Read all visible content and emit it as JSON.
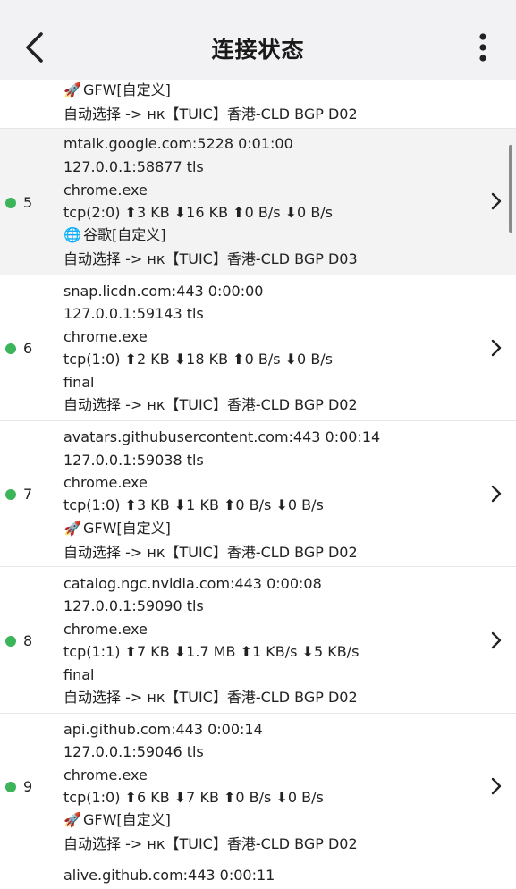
{
  "header": {
    "title": "连接状态"
  },
  "partial_top": {
    "rule": "GFW[自定义]",
    "rule_icon": "rocket-icon",
    "chain": "自动选择 -> нк【TUIC】香港-CLD BGP D02"
  },
  "rows": [
    {
      "index": "5",
      "host": "mtalk.google.com:5228  0:01:00",
      "src": "127.0.0.1:58877  tls",
      "process": "chrome.exe",
      "stats": "tcp(2:0)  ⬆3 KB  ⬇16 KB  ⬆0 B/s  ⬇0 B/s",
      "rule": "谷歌[自定义]",
      "rule_icon": "globe-icon",
      "chain": "自动选择 -> нк【TUIC】香港-CLD BGP D03"
    },
    {
      "index": "6",
      "host": "snap.licdn.com:443  0:00:00",
      "src": "127.0.0.1:59143  tls",
      "process": "chrome.exe",
      "stats": "tcp(1:0)  ⬆2 KB  ⬇18 KB  ⬆0 B/s  ⬇0 B/s",
      "rule": "final",
      "rule_icon": "",
      "chain": "自动选择 -> нк【TUIC】香港-CLD BGP D02"
    },
    {
      "index": "7",
      "host": "avatars.githubusercontent.com:443  0:00:14",
      "src": "127.0.0.1:59038  tls",
      "process": "chrome.exe",
      "stats": "tcp(1:0)  ⬆3 KB  ⬇1 KB  ⬆0 B/s  ⬇0 B/s",
      "rule": "GFW[自定义]",
      "rule_icon": "rocket-icon",
      "chain": "自动选择 -> нк【TUIC】香港-CLD BGP D02"
    },
    {
      "index": "8",
      "host": "catalog.ngc.nvidia.com:443  0:00:08",
      "src": "127.0.0.1:59090  tls",
      "process": "chrome.exe",
      "stats": "tcp(1:1)  ⬆7 KB  ⬇1.7 MB  ⬆1 KB/s  ⬇5 KB/s",
      "rule": "final",
      "rule_icon": "",
      "chain": "自动选择 -> нк【TUIC】香港-CLD BGP D02"
    },
    {
      "index": "9",
      "host": "api.github.com:443  0:00:14",
      "src": "127.0.0.1:59046  tls",
      "process": "chrome.exe",
      "stats": "tcp(1:0)  ⬆6 KB  ⬇7 KB  ⬆0 B/s  ⬇0 B/s",
      "rule": "GFW[自定义]",
      "rule_icon": "rocket-icon",
      "chain": "自动选择 -> нк【TUIC】香港-CLD BGP D02"
    }
  ],
  "partial_bottom": {
    "host": "alive.github.com:443  0:00:11"
  },
  "colors": {
    "active_dot": "#3cb55a",
    "header_bg": "#f2f2f4",
    "selected_row_bg": "#f3f3f3"
  }
}
